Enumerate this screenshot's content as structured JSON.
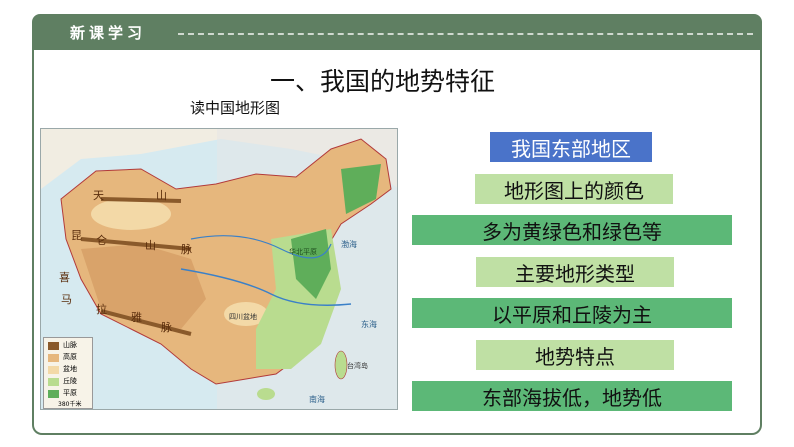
{
  "header": {
    "title": "新课学习"
  },
  "main": {
    "title": "一、我国的地势特征"
  },
  "map": {
    "caption": "读中国地形图",
    "labels": {
      "tian": "天",
      "kun": "昆",
      "lun": "仑",
      "xi": "喜",
      "ma": "马",
      "la": "拉",
      "ya": "雅",
      "shan1": "山",
      "shan2": "山",
      "mai1": "脉",
      "mai2": "脉",
      "sichuan": "四川盆地",
      "huabei": "华北平原",
      "bohai": "渤海",
      "donghai": "东海",
      "nanhai": "南海",
      "taiwan": "台湾岛"
    },
    "legend": {
      "items": [
        "山脉",
        "高原",
        "盆地",
        "丘陵",
        "平原"
      ],
      "scale": "380千米",
      "colors": [
        "#8a5a2b",
        "#e6b77d",
        "#f3d9a7",
        "#b9dc8f",
        "#5fae5a"
      ]
    }
  },
  "pills": [
    {
      "text": "我国东部地区",
      "style": "blue"
    },
    {
      "text": "地形图上的颜色",
      "style": "light"
    },
    {
      "text": "多为黄绿色和绿色等",
      "style": "dark"
    },
    {
      "text": "主要地形类型",
      "style": "light"
    },
    {
      "text": "以平原和丘陵为主",
      "style": "dark"
    },
    {
      "text": "地势特点",
      "style": "light"
    },
    {
      "text": "东部海拔低，地势低",
      "style": "dark"
    }
  ]
}
